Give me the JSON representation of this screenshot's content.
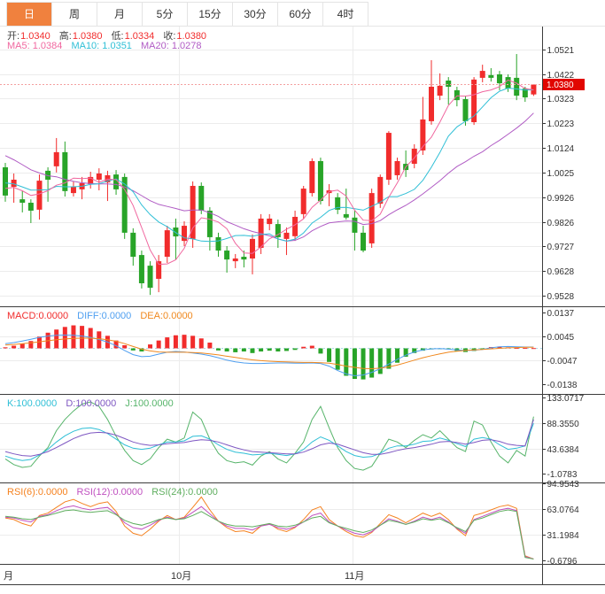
{
  "tabs": {
    "items": [
      {
        "label": "日",
        "active": true
      },
      {
        "label": "周",
        "active": false
      },
      {
        "label": "月",
        "active": false
      },
      {
        "label": "5分",
        "active": false
      },
      {
        "label": "15分",
        "active": false
      },
      {
        "label": "30分",
        "active": false
      },
      {
        "label": "60分",
        "active": false
      },
      {
        "label": "4时",
        "active": false
      }
    ]
  },
  "ohlc_row": {
    "open_l": "开:",
    "open_v": "1.0340",
    "high_l": "高:",
    "high_v": "1.0380",
    "low_l": "低:",
    "low_v": "1.0334",
    "close_l": "收:",
    "close_v": "1.0380"
  },
  "ma_row": {
    "ma5": "MA5: 1.0384",
    "ma10": "MA10: 1.0351",
    "ma20": "MA20: 1.0278"
  },
  "panels": {
    "macd": {
      "macd_label": "MACD:0.0000",
      "diff_label": "DIFF:0.0000",
      "dea_label": "DEA:0.0000"
    },
    "kdj": {
      "k_label": "K:100.0000",
      "d_label": "D:100.0000",
      "j_label": "J:100.0000"
    },
    "rsi": {
      "r6_label": "RSI(6):0.0000",
      "r12_label": "RSI(12):0.0000",
      "r24_label": "RSI(24):0.0000"
    }
  },
  "xaxis": {
    "sep": "月",
    "oct": "10月",
    "nov": "11月"
  },
  "colors": {
    "up": "#f12c2c",
    "down": "#28a428",
    "ma5": "#f0679f",
    "ma10": "#2fbfd6",
    "ma20": "#b05bc4",
    "diff": "#4f9ff0",
    "dea": "#f0881e",
    "k": "#2fbfd6",
    "d": "#7e57c2",
    "j": "#56b46a",
    "rsi6": "#f58220",
    "rsi12": "#c050c0",
    "rsi24": "#5fae5f",
    "active_tab": "#f0813e",
    "price_badge": "#e10600",
    "grid": "#ececec",
    "separator": "#3c3c3c",
    "dotted_price": "#f49f9f",
    "macd_zero": "#a8d8e8",
    "axis_text": "#333333"
  },
  "chart_data": {
    "type": "candlestick",
    "price_axis_ticks": [
      "1.0521",
      "1.0422",
      "1.0323",
      "1.0223",
      "1.0124",
      "1.0025",
      "0.9926",
      "0.9826",
      "0.9727",
      "0.9628",
      "0.9528"
    ],
    "price_axis_range": [
      0.9528,
      1.0521
    ],
    "current_price": "1.0380",
    "x_axis_labels": [
      "月",
      "10月",
      "11月"
    ],
    "month_gridlines_x": [
      202,
      398
    ],
    "candles_ohlc": [
      [
        1.0046,
        1.0064,
        0.9907,
        0.9932
      ],
      [
        0.9967,
        1.0021,
        0.9903,
        0.9996
      ],
      [
        0.9917,
        0.995,
        0.9864,
        0.9903
      ],
      [
        0.9903,
        0.9917,
        0.9821,
        0.9871
      ],
      [
        0.9875,
        1.0017,
        0.9835,
        0.9992
      ],
      [
        1.0032,
        1.0046,
        0.9907,
        0.9996
      ],
      [
        1.005,
        1.0164,
        1.0025,
        1.0107
      ],
      [
        1.0107,
        1.015,
        0.9928,
        0.995
      ],
      [
        0.9942,
        0.9989,
        0.9928,
        0.9967
      ],
      [
        0.9957,
        1.0007,
        0.9917,
        0.9982
      ],
      [
        0.9978,
        1.0028,
        0.996,
        1.0007
      ],
      [
        0.9996,
        1.0042,
        0.9953,
        1.0021
      ],
      [
        0.9985,
        1.0032,
        0.991,
        1.0014
      ],
      [
        1.0017,
        1.0035,
        0.9935,
        0.9957
      ],
      [
        1.0007,
        1.0021,
        0.9757,
        0.9782
      ],
      [
        0.9782,
        0.98,
        0.9649,
        0.9685
      ],
      [
        0.9692,
        0.971,
        0.9557,
        0.9578
      ],
      [
        0.9649,
        0.9667,
        0.9531,
        0.956
      ],
      [
        0.9596,
        0.9692,
        0.9542,
        0.9667
      ],
      [
        0.9685,
        0.981,
        0.966,
        0.9792
      ],
      [
        0.9803,
        0.9839,
        0.9674,
        0.9767
      ],
      [
        0.9749,
        0.9828,
        0.9728,
        0.981
      ],
      [
        0.9757,
        0.9989,
        0.9721,
        0.9971
      ],
      [
        0.9971,
        0.9985,
        0.9857,
        0.9871
      ],
      [
        0.9871,
        0.9885,
        0.971,
        0.9764
      ],
      [
        0.9764,
        0.9782,
        0.9685,
        0.971
      ],
      [
        0.971,
        0.9728,
        0.9621,
        0.9674
      ],
      [
        0.9667,
        0.9696,
        0.9639,
        0.9678
      ],
      [
        0.9685,
        0.971,
        0.9642,
        0.9674
      ],
      [
        0.9678,
        0.9775,
        0.9614,
        0.9757
      ],
      [
        0.9721,
        0.9857,
        0.9696,
        0.9839
      ],
      [
        0.9817,
        0.9857,
        0.9792,
        0.9839
      ],
      [
        0.9817,
        0.9835,
        0.9721,
        0.9764
      ],
      [
        0.9757,
        0.9803,
        0.9692,
        0.9782
      ],
      [
        0.9768,
        0.9871,
        0.9749,
        0.9846
      ],
      [
        0.9857,
        0.9971,
        0.9839,
        0.996
      ],
      [
        0.9942,
        1.0082,
        0.9928,
        1.0071
      ],
      [
        1.0071,
        1.0085,
        0.9896,
        0.991
      ],
      [
        0.9942,
        0.9978,
        0.9889,
        0.9953
      ],
      [
        0.9925,
        0.9942,
        0.9857,
        0.9875
      ],
      [
        0.9857,
        0.996,
        0.9835,
        0.9843
      ],
      [
        0.9843,
        0.9871,
        0.971,
        0.9782
      ],
      [
        0.9782,
        0.981,
        0.9703,
        0.971
      ],
      [
        0.9739,
        0.996,
        0.9721,
        0.9942
      ],
      [
        0.9899,
        1.0017,
        0.9882,
        1.0007
      ],
      [
        0.9996,
        1.0192,
        0.9975,
        1.0185
      ],
      [
        1.0014,
        1.0085,
        0.9996,
        1.0071
      ],
      [
        1.006,
        1.0114,
        1.0007,
        1.0035
      ],
      [
        1.006,
        1.0139,
        1.0042,
        1.0121
      ],
      [
        1.0114,
        1.033,
        1.0096,
        1.0239
      ],
      [
        1.0232,
        1.0478,
        1.0218,
        1.0371
      ],
      [
        1.0335,
        1.0425,
        1.0317,
        1.0375
      ],
      [
        1.0396,
        1.041,
        1.0299,
        1.0371
      ],
      [
        1.0357,
        1.0371,
        1.0292,
        1.0317
      ],
      [
        1.0321,
        1.0335,
        1.0214,
        1.0232
      ],
      [
        1.0228,
        1.041,
        1.0217,
        1.04
      ],
      [
        1.0407,
        1.046,
        1.0389,
        1.0435
      ],
      [
        1.0418,
        1.0446,
        1.0392,
        1.0407
      ],
      [
        1.0421,
        1.0435,
        1.0357,
        1.0385
      ],
      [
        1.041,
        1.0421,
        1.035,
        1.0364
      ],
      [
        1.0407,
        1.0503,
        1.0317,
        1.0335
      ],
      [
        1.0364,
        1.0371,
        1.031,
        1.0328
      ],
      [
        1.034,
        1.038,
        1.0334,
        1.038
      ]
    ],
    "ma_seed_closes": [
      1.035,
      1.033,
      1.03,
      1.028,
      1.025,
      1.022,
      1.019,
      1.016,
      1.013,
      1.01,
      1.007,
      1.004,
      1.002,
      1.0,
      0.999,
      0.998,
      0.9975,
      0.997,
      0.9965,
      0.996
    ],
    "macd": {
      "axis_ticks": [
        "0.0137",
        "0.0045",
        "-0.0047",
        "-0.0138"
      ],
      "hist": [
        0.0004,
        0.001,
        0.0018,
        0.0028,
        0.0045,
        0.006,
        0.0072,
        0.0082,
        0.0088,
        0.0086,
        0.0078,
        0.0065,
        0.0048,
        0.003,
        0.0012,
        -0.0008,
        -0.0012,
        0.0015,
        0.003,
        0.0042,
        0.005,
        0.0052,
        0.0048,
        0.0038,
        0.0022,
        -0.0008,
        -0.0012,
        -0.0015,
        -0.0012,
        -0.0018,
        -0.0012,
        -0.0009,
        -0.0012,
        -0.001,
        -0.0006,
        0.0006,
        0.001,
        -0.002,
        -0.0052,
        -0.0082,
        -0.0105,
        -0.0117,
        -0.0119,
        -0.0112,
        -0.0098,
        -0.0078,
        -0.0055,
        -0.0032,
        -0.0018,
        -0.0009,
        -0.0004,
        -0.0002,
        -0.0004,
        -0.001,
        -0.0014,
        -0.001,
        -0.0005,
        0.0005,
        0.0007,
        0.0004,
        0.0002,
        0.0002,
        0.0001
      ],
      "diff": [
        0.0018,
        0.0022,
        0.0028,
        0.0035,
        0.0042,
        0.0047,
        0.005,
        0.0051,
        0.005,
        0.0047,
        0.0042,
        0.0034,
        0.0024,
        0.001,
        -0.0008,
        -0.0024,
        -0.0032,
        -0.003,
        -0.0022,
        -0.0015,
        -0.0012,
        -0.0014,
        -0.0018,
        -0.0022,
        -0.0028,
        -0.0036,
        -0.0045,
        -0.0052,
        -0.0056,
        -0.0058,
        -0.0058,
        -0.0057,
        -0.0056,
        -0.0056,
        -0.0057,
        -0.0057,
        -0.0056,
        -0.0058,
        -0.0068,
        -0.0085,
        -0.0098,
        -0.0105,
        -0.0102,
        -0.0092,
        -0.0078,
        -0.006,
        -0.0042,
        -0.0026,
        -0.0014,
        -0.0006,
        -0.0002,
        -0.0001,
        -0.0003,
        -0.0006,
        -0.0008,
        -0.0007,
        -0.0004,
        0.0002,
        0.0006,
        0.0007,
        0.0006,
        0.0005,
        0.0005
      ],
      "dea": [
        0.0013,
        0.0015,
        0.0018,
        0.0021,
        0.0025,
        0.0029,
        0.0033,
        0.0036,
        0.0038,
        0.0039,
        0.0039,
        0.0037,
        0.0033,
        0.0027,
        0.0018,
        0.0007,
        -0.0003,
        -0.001,
        -0.0014,
        -0.0015,
        -0.0015,
        -0.0015,
        -0.0016,
        -0.0018,
        -0.0021,
        -0.0025,
        -0.003,
        -0.0035,
        -0.004,
        -0.0044,
        -0.0047,
        -0.0049,
        -0.0051,
        -0.0052,
        -0.0053,
        -0.0054,
        -0.0054,
        -0.0055,
        -0.0057,
        -0.0062,
        -0.0068,
        -0.0073,
        -0.0077,
        -0.0078,
        -0.0076,
        -0.0071,
        -0.0064,
        -0.0055,
        -0.0045,
        -0.0036,
        -0.0028,
        -0.0021,
        -0.0015,
        -0.0011,
        -0.0008,
        -0.0006,
        -0.0004,
        -0.0002,
        0.0,
        0.0002,
        0.0003,
        0.0004,
        0.0004
      ]
    },
    "kdj": {
      "axis_ticks": [
        "133.0717",
        "88.3550",
        "43.6384",
        "-1.0783"
      ],
      "k": [
        30,
        25,
        22,
        24,
        32,
        42,
        55,
        66,
        74,
        79,
        80,
        77,
        70,
        60,
        50,
        44,
        42,
        44,
        50,
        55,
        55,
        57,
        65,
        66,
        60,
        50,
        42,
        37,
        35,
        32,
        33,
        35,
        33,
        31,
        34,
        42,
        55,
        64,
        58,
        48,
        38,
        31,
        28,
        29,
        35,
        44,
        48,
        48,
        51,
        56,
        57,
        62,
        58,
        52,
        47,
        60,
        63,
        60,
        50,
        42,
        44,
        48,
        88
      ],
      "d": [
        38,
        34,
        31,
        30,
        33,
        38,
        45,
        53,
        61,
        67,
        71,
        72,
        71,
        67,
        61,
        55,
        51,
        49,
        50,
        52,
        53,
        54,
        57,
        59,
        58,
        55,
        50,
        45,
        41,
        38,
        37,
        36,
        35,
        34,
        34,
        37,
        43,
        50,
        53,
        51,
        46,
        41,
        36,
        33,
        33,
        36,
        40,
        43,
        45,
        48,
        51,
        55,
        56,
        54,
        51,
        54,
        58,
        59,
        56,
        51,
        49,
        48,
        95
      ],
      "j": [
        25,
        15,
        10,
        12,
        30,
        45,
        75,
        95,
        110,
        122,
        126,
        118,
        95,
        65,
        40,
        22,
        15,
        25,
        45,
        60,
        55,
        62,
        108,
        95,
        60,
        35,
        22,
        18,
        20,
        14,
        30,
        38,
        25,
        18,
        35,
        55,
        95,
        118,
        80,
        45,
        22,
        8,
        5,
        12,
        35,
        60,
        55,
        45,
        58,
        68,
        62,
        75,
        60,
        45,
        38,
        92,
        85,
        55,
        30,
        18,
        40,
        30,
        100
      ]
    },
    "rsi": {
      "axis_ticks": [
        "94.9543",
        "63.0764",
        "31.1984",
        "-0.6796"
      ],
      "rsi6": [
        52,
        50,
        45,
        42,
        55,
        58,
        65,
        72,
        75,
        70,
        66,
        70,
        72,
        60,
        42,
        33,
        30,
        38,
        48,
        55,
        50,
        53,
        65,
        78,
        62,
        48,
        40,
        35,
        36,
        33,
        42,
        45,
        38,
        35,
        40,
        50,
        62,
        66,
        50,
        42,
        35,
        30,
        28,
        34,
        45,
        56,
        52,
        46,
        52,
        58,
        54,
        58,
        50,
        38,
        30,
        55,
        58,
        62,
        66,
        68,
        64,
        5,
        1
      ],
      "rsi12": [
        53,
        52,
        49,
        47,
        54,
        56,
        61,
        65,
        67,
        64,
        62,
        64,
        65,
        57,
        46,
        40,
        38,
        43,
        49,
        53,
        50,
        52,
        59,
        66,
        57,
        48,
        42,
        39,
        39,
        37,
        42,
        44,
        40,
        38,
        41,
        47,
        55,
        58,
        47,
        42,
        37,
        33,
        31,
        35,
        43,
        51,
        48,
        44,
        48,
        53,
        50,
        53,
        47,
        39,
        33,
        50,
        54,
        58,
        62,
        64,
        61,
        4,
        1
      ],
      "rsi24": [
        54,
        53,
        51,
        50,
        53,
        55,
        58,
        61,
        62,
        60,
        59,
        60,
        61,
        56,
        49,
        45,
        43,
        46,
        50,
        52,
        50,
        51,
        55,
        60,
        54,
        48,
        44,
        42,
        42,
        41,
        43,
        45,
        42,
        41,
        43,
        47,
        52,
        54,
        46,
        42,
        39,
        36,
        34,
        37,
        43,
        49,
        47,
        44,
        47,
        51,
        49,
        51,
        46,
        40,
        35,
        49,
        52,
        56,
        60,
        62,
        60,
        3,
        1
      ]
    }
  }
}
